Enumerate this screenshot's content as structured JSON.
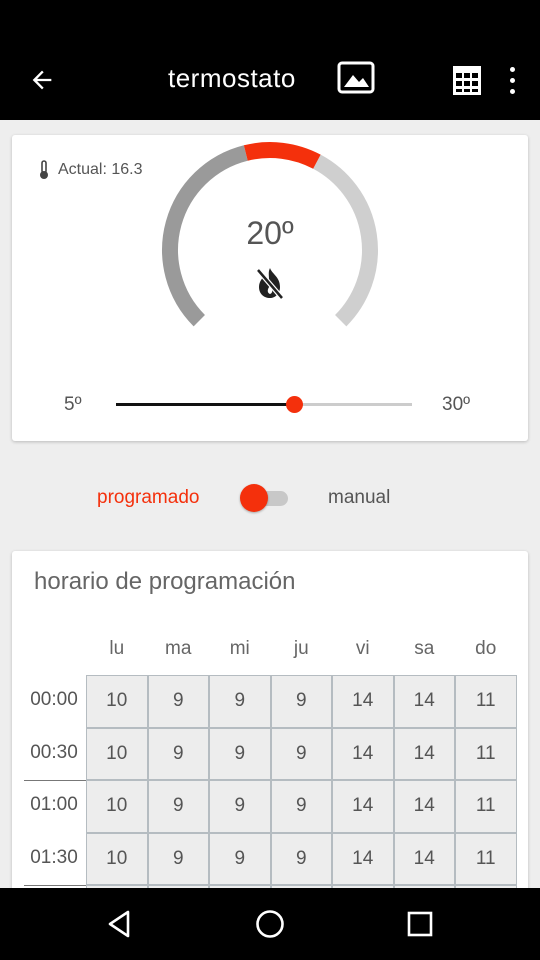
{
  "app_bar": {
    "title": "termostato",
    "icons": [
      "arrow-back-icon",
      "image-icon",
      "calendar-grid-icon",
      "more-vert-icon"
    ]
  },
  "thermostat": {
    "actual_label": "Actual: 16.3",
    "target_display": "20º",
    "target_value": 20,
    "slider_min_label": "5º",
    "slider_max_label": "30º",
    "slider_min": 5,
    "slider_max": 30,
    "heating_icon": "flame-off-icon"
  },
  "mode": {
    "programmed_label": "programado",
    "manual_label": "manual",
    "selected": "programado"
  },
  "schedule": {
    "title": "horario de programación",
    "days": [
      "lu",
      "ma",
      "mi",
      "ju",
      "vi",
      "sa",
      "do"
    ],
    "rows": [
      {
        "time": "00:00",
        "values": [
          "10",
          "9",
          "9",
          "9",
          "14",
          "14",
          "11"
        ]
      },
      {
        "time": "00:30",
        "values": [
          "10",
          "9",
          "9",
          "9",
          "14",
          "14",
          "11"
        ]
      },
      {
        "time": "01:00",
        "values": [
          "10",
          "9",
          "9",
          "9",
          "14",
          "14",
          "11"
        ]
      },
      {
        "time": "01:30",
        "values": [
          "10",
          "9",
          "9",
          "9",
          "14",
          "14",
          "11"
        ]
      },
      {
        "time": "",
        "values": [
          "",
          "",
          "",
          "",
          "",
          "",
          ""
        ]
      }
    ]
  },
  "colors": {
    "accent": "#f4300c",
    "dial_dark": "#9a9a9a",
    "dial_light": "#cfcfcf",
    "bar": "#000000"
  },
  "nav": {
    "icons": [
      "nav-back-icon",
      "nav-home-icon",
      "nav-recents-icon"
    ]
  }
}
